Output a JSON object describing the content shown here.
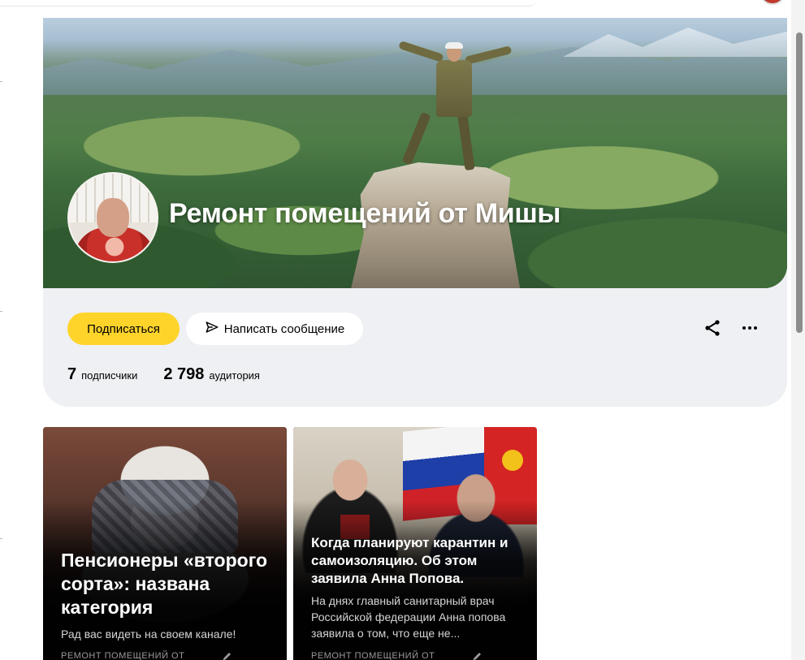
{
  "channel": {
    "title": "Ремонт помещений от Мишы",
    "subscribe_label": "Подписаться",
    "message_label": "Написать сообщение",
    "stats": {
      "subscribers_count": "7",
      "subscribers_label": "подписчики",
      "audience_count": "2 798",
      "audience_label": "аудитория"
    }
  },
  "articles": [
    {
      "title": "Пенсионеры «второго сорта»: названа категория",
      "snippet": "Рад вас видеть на своем канале!",
      "source": "Ремонт помещений от"
    },
    {
      "title": "Когда планируют карантин и самоизоляцию. Об этом заявила Анна Попова.",
      "snippet": "На днях главный санитарный врач Российской федерации Анна попова заявила о том, что еще не...",
      "source": "Ремонт помещений от"
    }
  ],
  "icons": {
    "share": "share-icon",
    "more": "more-icon",
    "send": "send-icon"
  },
  "colors": {
    "accent_yellow": "#fed42b",
    "card_background": "#eff0f3"
  }
}
